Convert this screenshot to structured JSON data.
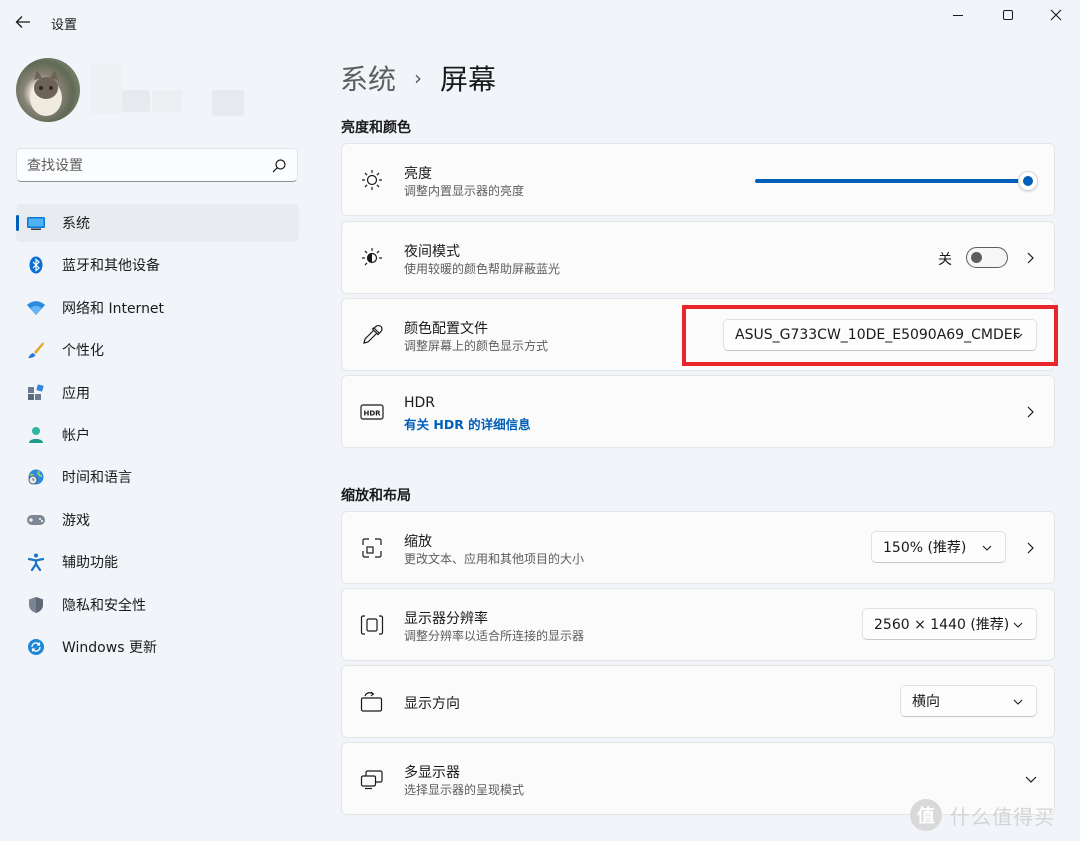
{
  "window": {
    "app_title": "设置",
    "back_icon": "back-arrow-icon",
    "controls": [
      "minimize-icon",
      "maximize-icon",
      "close-icon"
    ]
  },
  "search": {
    "placeholder": "查找设置",
    "value": ""
  },
  "sidebar": {
    "items": [
      {
        "label": "系统",
        "icon": "system-icon",
        "active": true
      },
      {
        "label": "蓝牙和其他设备",
        "icon": "bluetooth-icon"
      },
      {
        "label": "网络和 Internet",
        "icon": "wifi-icon"
      },
      {
        "label": "个性化",
        "icon": "brush-icon"
      },
      {
        "label": "应用",
        "icon": "apps-icon"
      },
      {
        "label": "帐户",
        "icon": "account-icon"
      },
      {
        "label": "时间和语言",
        "icon": "globe-clock-icon"
      },
      {
        "label": "游戏",
        "icon": "gamepad-icon"
      },
      {
        "label": "辅助功能",
        "icon": "accessibility-icon"
      },
      {
        "label": "隐私和安全性",
        "icon": "shield-icon"
      },
      {
        "label": "Windows 更新",
        "icon": "update-icon"
      }
    ]
  },
  "breadcrumb": {
    "parent": "系统",
    "separator": "›",
    "current": "屏幕"
  },
  "sections": {
    "brightness_color": "亮度和颜色",
    "scale_layout": "缩放和布局"
  },
  "brightness": {
    "title": "亮度",
    "subtitle": "调整内置显示器的亮度",
    "value_percent": 100,
    "icon": "sun-icon"
  },
  "night_light": {
    "title": "夜间模式",
    "subtitle": "使用较暖的颜色帮助屏蔽蓝光",
    "state_label": "关",
    "on": false,
    "icon": "night-light-icon"
  },
  "color_profile": {
    "title": "颜色配置文件",
    "subtitle": "调整屏幕上的颜色显示方式",
    "selected": "ASUS_G733CW_10DE_E5090A69_CMDEF",
    "icon": "eyedropper-icon",
    "highlight_color": "#e8262b"
  },
  "hdr": {
    "title": "HDR",
    "link": "有关 HDR 的详细信息",
    "icon": "hdr-icon"
  },
  "scale": {
    "title": "缩放",
    "subtitle": "更改文本、应用和其他项目的大小",
    "selected": "150% (推荐)",
    "icon": "scale-icon"
  },
  "resolution": {
    "title": "显示器分辨率",
    "subtitle": "调整分辨率以适合所连接的显示器",
    "selected": "2560 × 1440 (推荐)",
    "icon": "resolution-icon"
  },
  "orientation": {
    "title": "显示方向",
    "selected": "横向",
    "icon": "orientation-icon"
  },
  "multi_display": {
    "title": "多显示器",
    "subtitle": "选择显示器的呈现模式",
    "icon": "multi-display-icon"
  },
  "watermark": {
    "badge": "值",
    "text": "什么值得买"
  },
  "colors": {
    "accent": "#005fb8",
    "background": "#f1f4f9",
    "card": "#fbfbfc"
  }
}
